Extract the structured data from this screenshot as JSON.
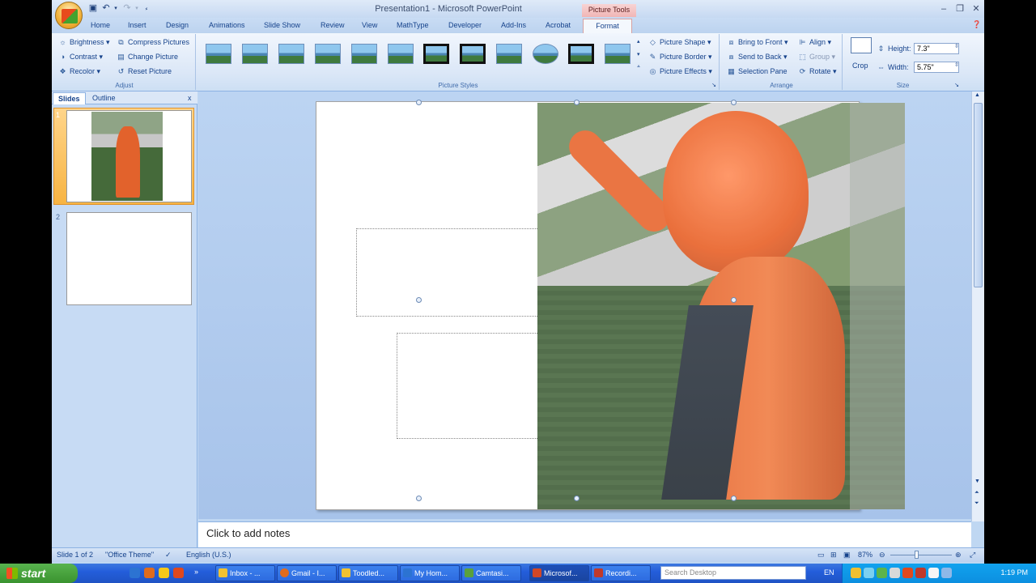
{
  "window": {
    "title": "Presentation1 - Microsoft PowerPoint",
    "contextual_tab": "Picture Tools"
  },
  "tabs": [
    "Home",
    "Insert",
    "Design",
    "Animations",
    "Slide Show",
    "Review",
    "View",
    "MathType",
    "Developer",
    "Add-Ins",
    "Acrobat",
    "Format"
  ],
  "ribbon": {
    "adjust": {
      "label": "Adjust",
      "brightness": "Brightness",
      "contrast": "Contrast",
      "recolor": "Recolor",
      "compress": "Compress Pictures",
      "change": "Change Picture",
      "reset": "Reset Picture"
    },
    "picture_styles": {
      "label": "Picture Styles",
      "shape": "Picture Shape",
      "border": "Picture Border",
      "effects": "Picture Effects"
    },
    "arrange": {
      "label": "Arrange",
      "bring_front": "Bring to Front",
      "send_back": "Send to Back",
      "selection_pane": "Selection Pane",
      "align": "Align",
      "group": "Group",
      "rotate": "Rotate"
    },
    "size": {
      "label": "Size",
      "crop": "Crop",
      "height_label": "Height:",
      "height_value": "7.3\"",
      "width_label": "Width:",
      "width_value": "5.75\""
    }
  },
  "left_pane": {
    "tab_slides": "Slides",
    "tab_outline": "Outline",
    "close": "x",
    "slide_numbers": [
      "1",
      "2"
    ]
  },
  "notes": {
    "placeholder": "Click to add notes"
  },
  "status": {
    "slide_info": "Slide 1 of 2",
    "theme": "\"Office Theme\"",
    "language": "English (U.S.)",
    "zoom": "87%"
  },
  "taskbar": {
    "start": "start",
    "buttons": [
      "Inbox - ...",
      "Gmail - I...",
      "Toodled...",
      "My Hom...",
      "Camtasi...",
      "Microsof...",
      "Recordi..."
    ],
    "search_placeholder": "Search Desktop",
    "lang": "EN",
    "clock": "1:19 PM"
  },
  "colors": {
    "accent": "#15428b",
    "ribbon_bg": "#dbe7f7",
    "contextual_tab": "#f0b5b5",
    "taskbar": "#245edb",
    "start": "#3a932f"
  }
}
